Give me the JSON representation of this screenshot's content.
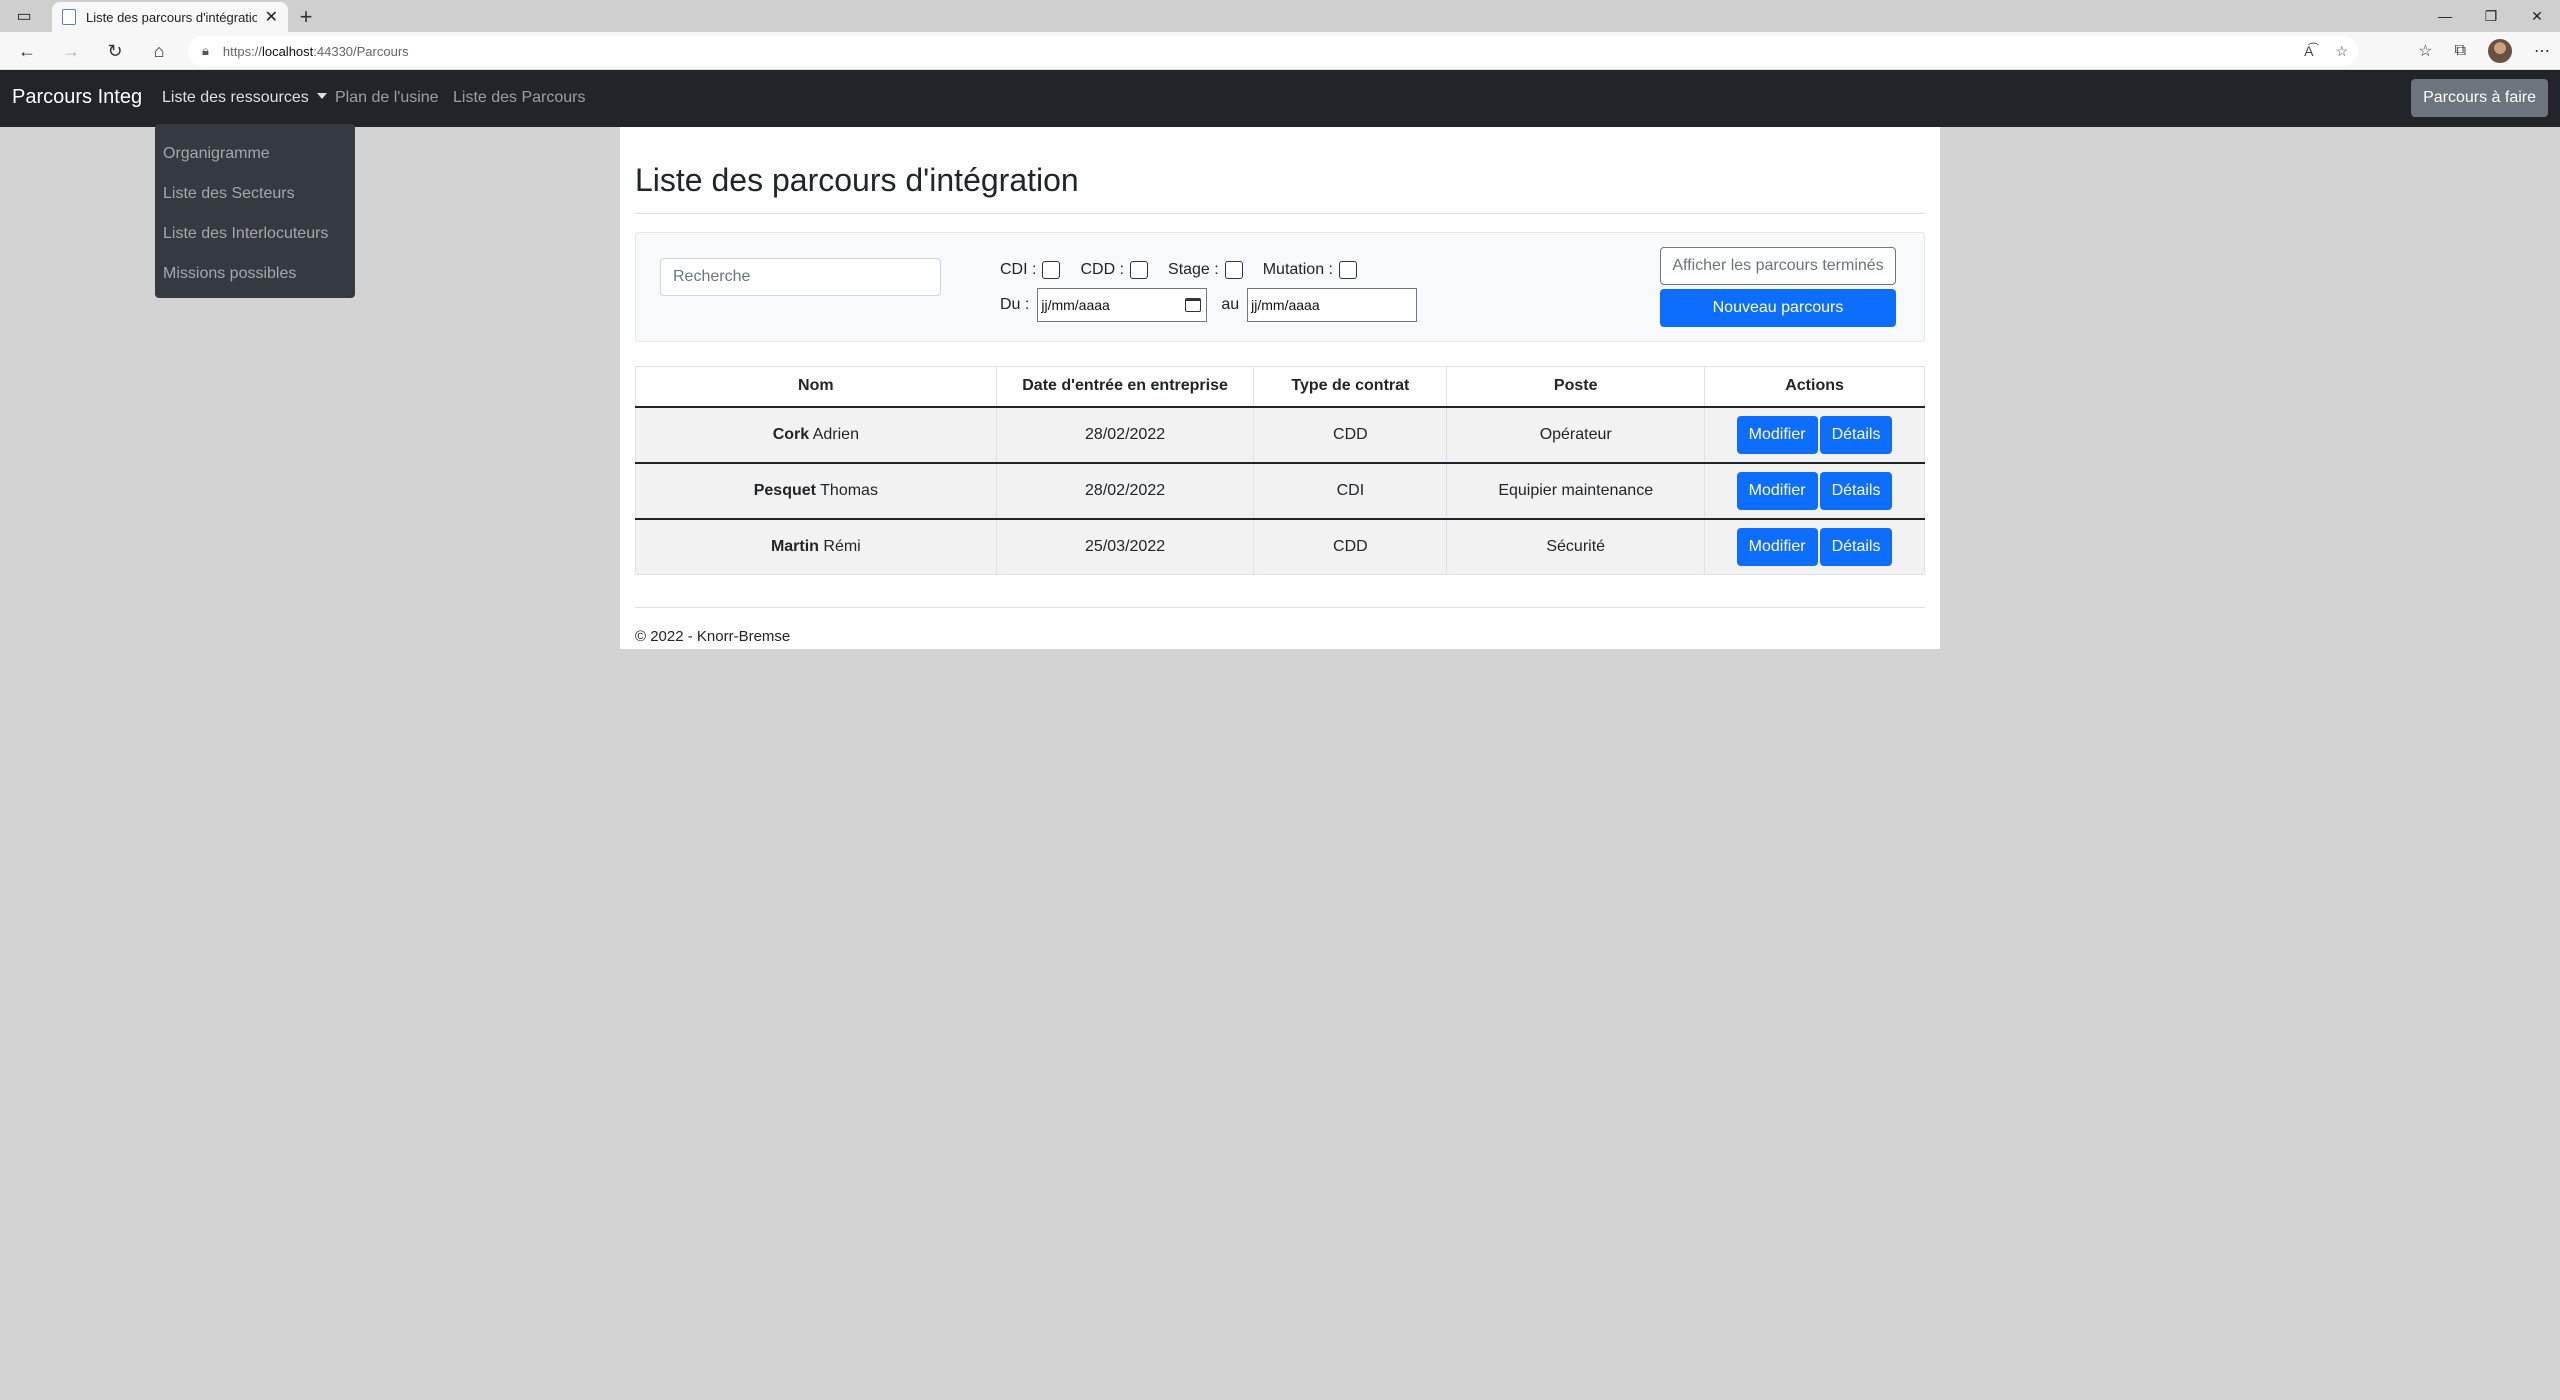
{
  "browser": {
    "tab_title": "Liste des parcours d'intégration",
    "url_proto": "https://",
    "url_host": "localhost",
    "url_path": ":44330/Parcours"
  },
  "navbar": {
    "brand": "Parcours Integ",
    "links": [
      "Liste des ressources",
      "Plan de l'usine",
      "Liste des Parcours"
    ],
    "right_button": "Parcours à faire"
  },
  "dropdown": {
    "items": [
      "Organigramme",
      "Liste des Secteurs",
      "Liste des Interlocuteurs",
      "Missions possibles"
    ]
  },
  "page": {
    "title": "Liste des parcours d'intégration",
    "search_placeholder": "Recherche",
    "filters": {
      "cdi": "CDI :",
      "cdd": "CDD :",
      "stage": "Stage :",
      "mutation": "Mutation :",
      "du": "Du :",
      "au": "au",
      "date_placeholder": "jj/mm/aaaa"
    },
    "show_done_button": "Afficher les parcours terminés",
    "new_button": "Nouveau parcours"
  },
  "table": {
    "headers": [
      "Nom",
      "Date d'entrée en entreprise",
      "Type de contrat",
      "Poste",
      "Actions"
    ],
    "rows": [
      {
        "last": "Cork",
        "first": "Adrien",
        "date": "28/02/2022",
        "contract": "CDD",
        "post": "Opérateur"
      },
      {
        "last": "Pesquet",
        "first": "Thomas",
        "date": "28/02/2022",
        "contract": "CDI",
        "post": "Equipier maintenance"
      },
      {
        "last": "Martin",
        "first": "Rémi",
        "date": "25/03/2022",
        "contract": "CDD",
        "post": "Sécurité"
      }
    ],
    "edit_label": "Modifier",
    "details_label": "Détails"
  },
  "footer": {
    "text": "© 2022 - Knorr-Bremse"
  },
  "colors": {
    "primary": "#0d6efd",
    "navbar": "#212529",
    "secondary": "#6c757d"
  }
}
